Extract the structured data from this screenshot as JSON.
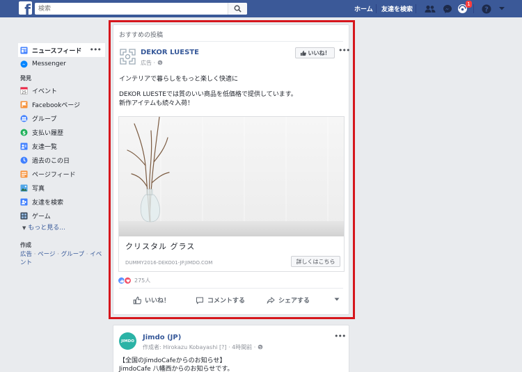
{
  "topbar": {
    "search_placeholder": "検索",
    "home_label": "ホーム",
    "find_friends_label": "友達を検索",
    "notification_count": "1",
    "brand_color": "#3b5998"
  },
  "left_nav": {
    "items": [
      {
        "label": "ニュースフィード",
        "icon": "news-feed-icon"
      },
      {
        "label": "Messenger",
        "icon": "messenger-icon"
      }
    ],
    "discover_heading": "発見",
    "discover_items": [
      {
        "label": "イベント",
        "icon": "calendar-icon"
      },
      {
        "label": "Facebookページ",
        "icon": "flag-icon"
      },
      {
        "label": "グループ",
        "icon": "groups-icon"
      },
      {
        "label": "支払い履歴",
        "icon": "payment-icon"
      },
      {
        "label": "友達一覧",
        "icon": "friend-list-icon"
      },
      {
        "label": "過去のこの日",
        "icon": "clock-icon"
      },
      {
        "label": "ページフィード",
        "icon": "pages-feed-icon"
      },
      {
        "label": "写真",
        "icon": "photo-icon"
      },
      {
        "label": "友達を検索",
        "icon": "find-friends-icon"
      },
      {
        "label": "ゲーム",
        "icon": "game-icon"
      }
    ],
    "see_more": "もっと見る...",
    "create_heading": "作成",
    "create_links": [
      "広告",
      "ページ",
      "グループ",
      "イベント"
    ]
  },
  "post": {
    "header": "おすすめの投稿",
    "page_name": "DEKOR LUESTE",
    "sponsored": "広告 ·",
    "like_button": "いいね！",
    "text_line1": "インテリアで暮らしをもっと楽しく快適に",
    "text_line2": "DEKOR LUESTEでは質のいい商品を低価格で提供しています。",
    "text_line3": "新作アイテムも続々入荷！",
    "ad_title": "クリスタル グラス",
    "ad_domain": "DUMMY2016-DEKO01-JP.JIMDO.COM",
    "cta": "詳しくはこちら",
    "reaction_count": "275人",
    "actions": {
      "like": "いいね！",
      "comment": "コメントする",
      "share": "シェアする"
    },
    "highlight_color": "#d6161c"
  },
  "post2": {
    "page_name": "Jimdo (JP)",
    "author_prefix": "作成者: Hirokazu Kobayashi [?] · 4時間前 ·",
    "text_line1": "【全国のJimdoCafeからのお知らせ】",
    "text_line2": "JimdoCafe 八幡西からのお知らせです。",
    "logo_text": "JIMDO"
  }
}
